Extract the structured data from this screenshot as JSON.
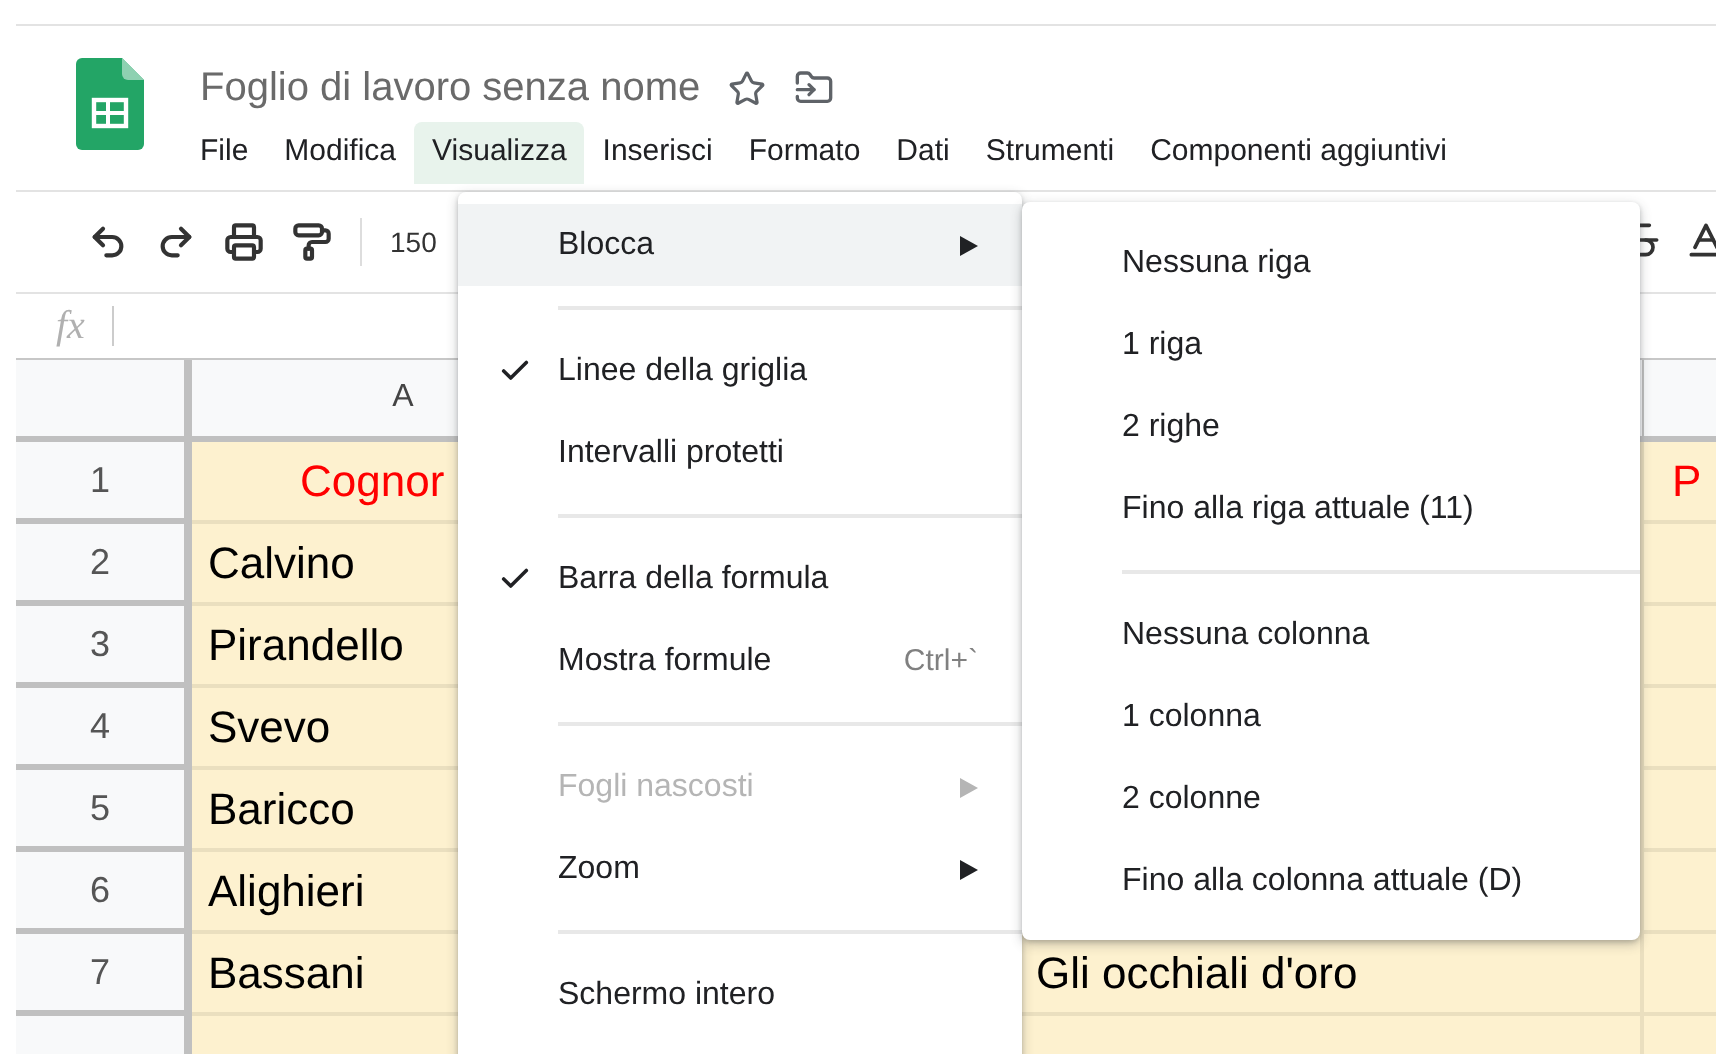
{
  "document": {
    "title": "Foglio di lavoro senza nome"
  },
  "menu_bar": [
    {
      "label": "File",
      "selected": false
    },
    {
      "label": "Modifica",
      "selected": false
    },
    {
      "label": "Visualizza",
      "selected": true
    },
    {
      "label": "Inserisci",
      "selected": false
    },
    {
      "label": "Formato",
      "selected": false
    },
    {
      "label": "Dati",
      "selected": false
    },
    {
      "label": "Strumenti",
      "selected": false
    },
    {
      "label": "Componenti aggiuntivi",
      "selected": false
    }
  ],
  "toolbar": {
    "zoom": "150"
  },
  "formula_bar": {
    "label": "fx"
  },
  "grid": {
    "column_header": "A",
    "rows": [
      {
        "number": "1",
        "kind": "heading",
        "column_a": "Cognor",
        "column_d": "P"
      },
      {
        "number": "2",
        "kind": "data",
        "column_a": "Calvino"
      },
      {
        "number": "3",
        "kind": "data",
        "column_a": "Pirandello"
      },
      {
        "number": "4",
        "kind": "data",
        "column_a": "Svevo"
      },
      {
        "number": "5",
        "kind": "data",
        "column_a": "Baricco"
      },
      {
        "number": "6",
        "kind": "data",
        "column_a": "Alighieri"
      },
      {
        "number": "7",
        "kind": "data",
        "column_a": "Bassani",
        "column_c": "Gli occhiali d'oro"
      }
    ]
  },
  "view_menu": [
    {
      "kind": "item",
      "label": "Blocca",
      "checked": false,
      "disabled": false,
      "submenu": true,
      "highlighted": true
    },
    {
      "kind": "separator"
    },
    {
      "kind": "item",
      "label": "Linee della griglia",
      "checked": true,
      "disabled": false,
      "submenu": false,
      "highlighted": false
    },
    {
      "kind": "item",
      "label": "Intervalli protetti",
      "checked": false,
      "disabled": false,
      "submenu": false,
      "highlighted": false
    },
    {
      "kind": "separator"
    },
    {
      "kind": "item",
      "label": "Barra della formula",
      "checked": true,
      "disabled": false,
      "submenu": false,
      "highlighted": false
    },
    {
      "kind": "item",
      "label": "Mostra formule",
      "shortcut": "Ctrl+`",
      "checked": false,
      "disabled": false,
      "submenu": false,
      "highlighted": false
    },
    {
      "kind": "separator"
    },
    {
      "kind": "item",
      "label": "Fogli nascosti",
      "checked": false,
      "disabled": true,
      "submenu": true,
      "highlighted": false
    },
    {
      "kind": "item",
      "label": "Zoom",
      "checked": false,
      "disabled": false,
      "submenu": true,
      "highlighted": false
    },
    {
      "kind": "separator"
    },
    {
      "kind": "item",
      "label": "Schermo intero",
      "checked": false,
      "disabled": false,
      "submenu": false,
      "highlighted": false
    }
  ],
  "freeze_submenu": [
    {
      "kind": "item",
      "label": "Nessuna riga"
    },
    {
      "kind": "item",
      "label": "1 riga"
    },
    {
      "kind": "item",
      "label": "2 righe"
    },
    {
      "kind": "item",
      "label": "Fino alla riga attuale (11)"
    },
    {
      "kind": "separator"
    },
    {
      "kind": "item",
      "label": "Nessuna colonna"
    },
    {
      "kind": "item",
      "label": "1 colonna"
    },
    {
      "kind": "item",
      "label": "2 colonne"
    },
    {
      "kind": "item",
      "label": "Fino alla colonna attuale (D)"
    }
  ]
}
